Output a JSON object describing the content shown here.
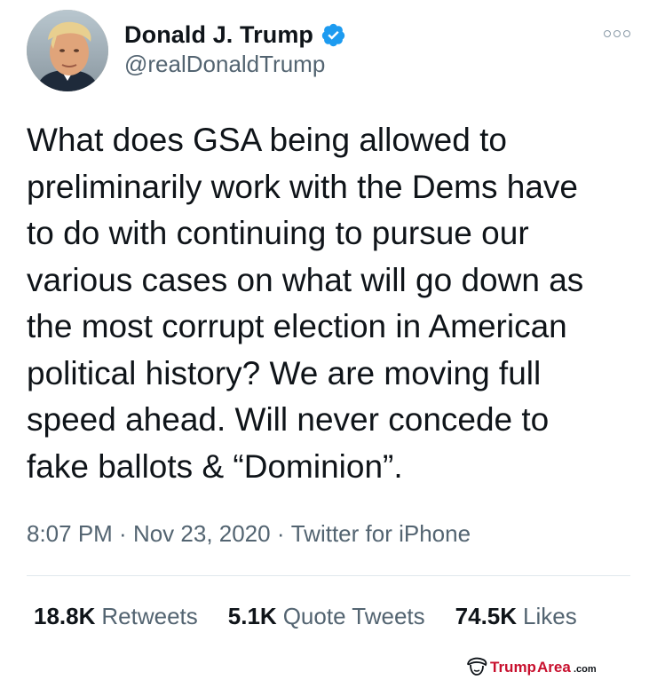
{
  "tweet": {
    "author": {
      "display_name": "Donald J. Trump",
      "handle": "@realDonaldTrump",
      "verified_icon": "verified-badge-icon",
      "avatar_icon": "profile-photo"
    },
    "more_icon": "more-options-icon",
    "text": "What does GSA being allowed to\npreliminarily work with the Dems have\nto do with continuing to pursue our\nvarious cases on what will go down as\nthe most corrupt election in American\npolitical history? We are moving full\nspeed ahead. Will never concede to\nfake ballots & “Dominion”.",
    "meta": {
      "time": "8:07 PM",
      "separator": " · ",
      "date": "Nov 23, 2020",
      "source": "Twitter for iPhone"
    },
    "stats": [
      {
        "count": "18.8K",
        "label": "Retweets"
      },
      {
        "count": "5.1K",
        "label": "Quote Tweets"
      },
      {
        "count": "74.5K",
        "label": "Likes"
      }
    ]
  },
  "watermark": {
    "text": "TrumpArea.com",
    "icon": "trump-hair-logo-icon"
  },
  "colors": {
    "text_primary": "#0f1419",
    "text_secondary": "#536471",
    "verified_blue": "#1d9bf0",
    "divider": "#e1e8ed",
    "watermark_red": "#c8102e"
  }
}
